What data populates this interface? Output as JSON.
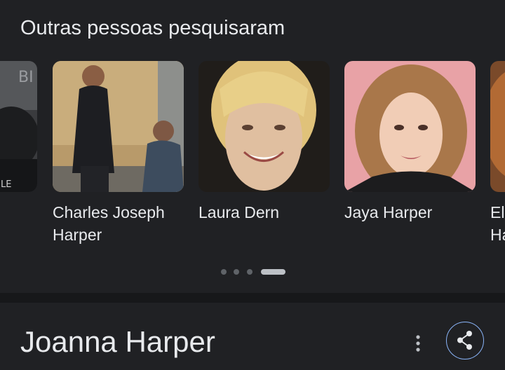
{
  "section": {
    "title": "Outras pessoas pesquisaram"
  },
  "people": [
    {
      "name": "",
      "partial": true
    },
    {
      "name": "Charles Joseph Harper"
    },
    {
      "name": "Laura Dern"
    },
    {
      "name": "Jaya Harper"
    },
    {
      "name": "El Ha",
      "partial": true
    }
  ],
  "carousel": {
    "page_count": 4,
    "active_page": 4
  },
  "entity": {
    "title": "Joanna Harper"
  },
  "icons": {
    "more": "more-vert-icon",
    "share": "share-icon"
  },
  "colors": {
    "background": "#202124",
    "text": "#e8eaed",
    "share_border": "#8ab4f8"
  }
}
